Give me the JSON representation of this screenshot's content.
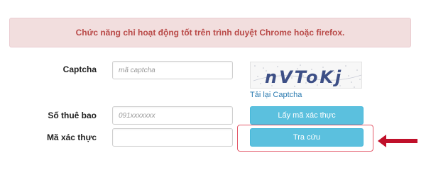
{
  "alert": {
    "message": "Chức năng chỉ hoạt động tốt trên trình duyệt Chrome hoặc firefox."
  },
  "form": {
    "captcha_label": "Captcha",
    "captcha_placeholder": "mã captcha",
    "captcha_image_text": "nVToKj",
    "reload_captcha_link": "Tải lại Captcha",
    "subscriber_label": "Số thuê bao",
    "subscriber_placeholder": "091xxxxxxx",
    "get_code_button": "Lấy mã xác thực",
    "verify_label": "Mã xác thực",
    "verify_value": "",
    "lookup_button": "Tra cứu"
  },
  "colors": {
    "alert_bg": "#f2dede",
    "alert_text": "#b94a48",
    "button_bg": "#5bc0de",
    "highlight": "#e45b6b",
    "arrow": "#c0102a",
    "link": "#2a7ab0"
  },
  "icons": {
    "annotation_arrow": "left-arrow-icon"
  }
}
